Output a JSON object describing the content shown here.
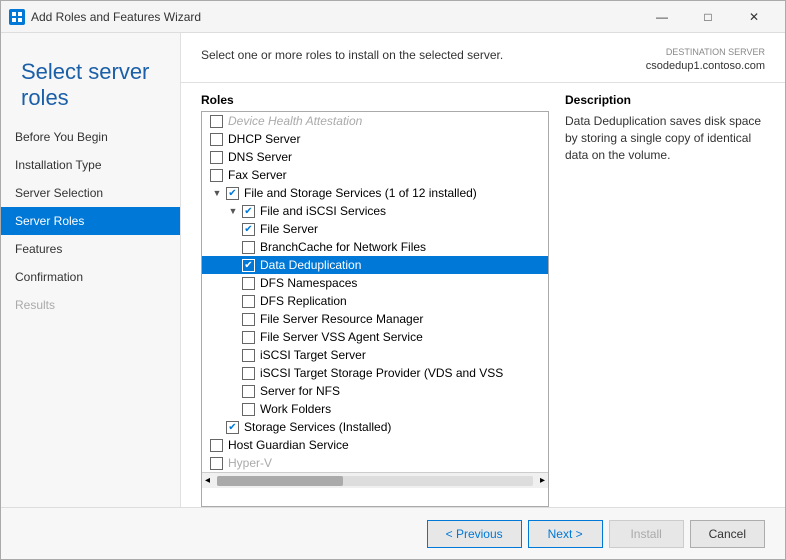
{
  "window": {
    "title": "Add Roles and Features Wizard",
    "controls": {
      "minimize": "—",
      "maximize": "□",
      "close": "✕"
    }
  },
  "header": {
    "page_title": "Select server roles",
    "destination_server_label": "DESTINATION SERVER",
    "destination_server_value": "csodedup1.contoso.com"
  },
  "sidebar": {
    "items": [
      {
        "label": "Before You Begin",
        "state": "normal"
      },
      {
        "label": "Installation Type",
        "state": "normal"
      },
      {
        "label": "Server Selection",
        "state": "normal"
      },
      {
        "label": "Server Roles",
        "state": "active"
      },
      {
        "label": "Features",
        "state": "normal"
      },
      {
        "label": "Confirmation",
        "state": "normal"
      },
      {
        "label": "Results",
        "state": "disabled"
      }
    ]
  },
  "main": {
    "instruction": "Select one or more roles to install on the selected server.",
    "roles_label": "Roles",
    "description_label": "Description",
    "description_text": "Data Deduplication saves disk space by storing a single copy of identical data on the volume."
  },
  "roles_list": [
    {
      "indent": 1,
      "label": "Device Health Attestation",
      "checked": false,
      "has_toggle": false,
      "toggle_open": false,
      "type": "item"
    },
    {
      "indent": 1,
      "label": "DHCP Server",
      "checked": false,
      "has_toggle": false,
      "type": "item"
    },
    {
      "indent": 1,
      "label": "DNS Server",
      "checked": false,
      "has_toggle": false,
      "type": "item"
    },
    {
      "indent": 1,
      "label": "Fax Server",
      "checked": false,
      "has_toggle": false,
      "type": "item"
    },
    {
      "indent": 1,
      "label": "File and Storage Services (1 of 12 installed)",
      "checked": true,
      "has_toggle": true,
      "toggle_open": true,
      "type": "parent"
    },
    {
      "indent": 2,
      "label": "File and iSCSI Services",
      "checked": true,
      "has_toggle": true,
      "toggle_open": true,
      "type": "parent"
    },
    {
      "indent": 3,
      "label": "File Server",
      "checked": true,
      "has_toggle": false,
      "type": "item"
    },
    {
      "indent": 3,
      "label": "BranchCache for Network Files",
      "checked": false,
      "has_toggle": false,
      "type": "item"
    },
    {
      "indent": 3,
      "label": "Data Deduplication",
      "checked": true,
      "has_toggle": false,
      "type": "item",
      "selected": true
    },
    {
      "indent": 3,
      "label": "DFS Namespaces",
      "checked": false,
      "has_toggle": false,
      "type": "item"
    },
    {
      "indent": 3,
      "label": "DFS Replication",
      "checked": false,
      "has_toggle": false,
      "type": "item"
    },
    {
      "indent": 3,
      "label": "File Server Resource Manager",
      "checked": false,
      "has_toggle": false,
      "type": "item"
    },
    {
      "indent": 3,
      "label": "File Server VSS Agent Service",
      "checked": false,
      "has_toggle": false,
      "type": "item"
    },
    {
      "indent": 3,
      "label": "iSCSI Target Server",
      "checked": false,
      "has_toggle": false,
      "type": "item"
    },
    {
      "indent": 3,
      "label": "iSCSI Target Storage Provider (VDS and VSS",
      "checked": false,
      "has_toggle": false,
      "type": "item"
    },
    {
      "indent": 3,
      "label": "Server for NFS",
      "checked": false,
      "has_toggle": false,
      "type": "item"
    },
    {
      "indent": 3,
      "label": "Work Folders",
      "checked": false,
      "has_toggle": false,
      "type": "item"
    },
    {
      "indent": 2,
      "label": "Storage Services (Installed)",
      "checked": true,
      "has_toggle": false,
      "type": "item"
    },
    {
      "indent": 1,
      "label": "Host Guardian Service",
      "checked": false,
      "has_toggle": false,
      "type": "item"
    },
    {
      "indent": 1,
      "label": "Hyper-V",
      "checked": false,
      "has_toggle": false,
      "type": "item"
    }
  ],
  "footer": {
    "previous_label": "< Previous",
    "next_label": "Next >",
    "install_label": "Install",
    "cancel_label": "Cancel"
  }
}
